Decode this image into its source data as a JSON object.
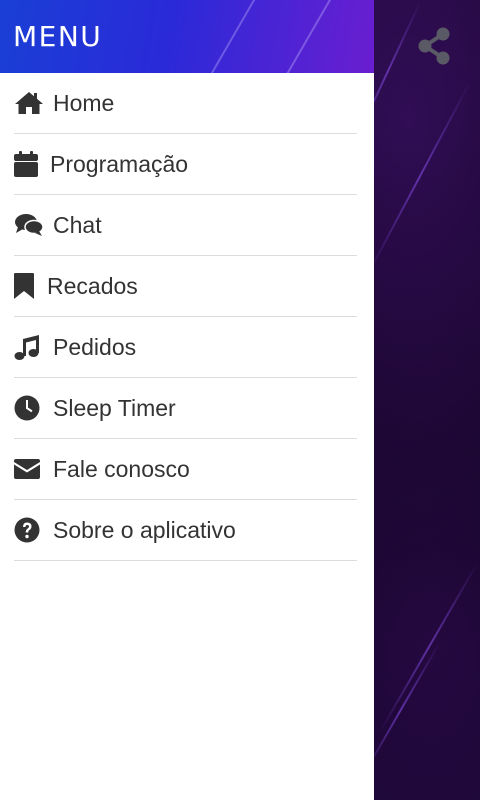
{
  "header": {
    "title": "MENU"
  },
  "menu": {
    "items": [
      {
        "label": "Home",
        "icon": "home-icon"
      },
      {
        "label": "Programação",
        "icon": "calendar-icon"
      },
      {
        "label": "Chat",
        "icon": "chat-icon"
      },
      {
        "label": "Recados",
        "icon": "bookmark-icon"
      },
      {
        "label": "Pedidos",
        "icon": "music-icon"
      },
      {
        "label": "Sleep Timer",
        "icon": "clock-icon"
      },
      {
        "label": "Fale conosco",
        "icon": "envelope-icon"
      },
      {
        "label": "Sobre o aplicativo",
        "icon": "help-icon"
      }
    ]
  },
  "toolbar": {
    "share_icon": "share-icon"
  },
  "colors": {
    "header_start": "#1a3fd6",
    "header_end": "#6a1ed0",
    "icon": "#333333",
    "text": "#333333",
    "divider": "#dcdcdc",
    "background": "#10041e",
    "share_icon": "#5a5a66"
  }
}
